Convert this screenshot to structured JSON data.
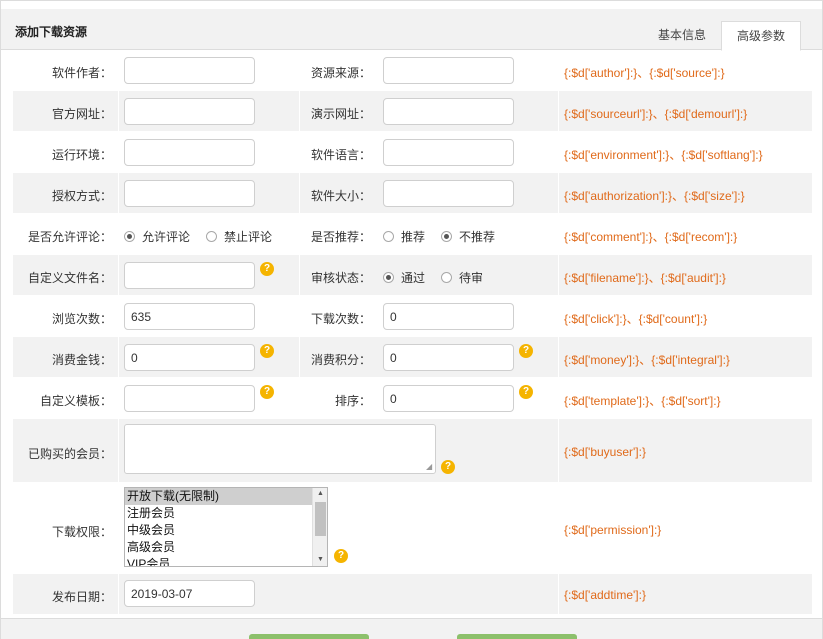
{
  "header": {
    "title": "添加下载资源"
  },
  "tabs": {
    "basic": "基本信息",
    "advanced": "高级参数"
  },
  "rows": {
    "author": {
      "label": "软件作者：",
      "value": ""
    },
    "source": {
      "label": "资源来源：",
      "value": ""
    },
    "author_code": "{:$d['author']:}、{:$d['source']:}",
    "sourceurl": {
      "label": "官方网址：",
      "value": ""
    },
    "demourl": {
      "label": "演示网址：",
      "value": ""
    },
    "url_code": "{:$d['sourceurl']:}、{:$d['demourl']:}",
    "environment": {
      "label": "运行环境：",
      "value": ""
    },
    "softlang": {
      "label": "软件语言：",
      "value": ""
    },
    "env_code": "{:$d['environment']:}、{:$d['softlang']:}",
    "authorization": {
      "label": "授权方式：",
      "value": ""
    },
    "size": {
      "label": "软件大小：",
      "value": ""
    },
    "auth_code": "{:$d['authorization']:}、{:$d['size']:}",
    "comment": {
      "label": "是否允许评论：",
      "opt_allow": "允许评论",
      "opt_forbid": "禁止评论",
      "selected": "允许评论"
    },
    "recom": {
      "label": "是否推荐：",
      "opt_yes": "推荐",
      "opt_no": "不推荐",
      "selected": "不推荐"
    },
    "comment_code": "{:$d['comment']:}、{:$d['recom']:}",
    "filename": {
      "label": "自定义文件名：",
      "value": ""
    },
    "audit": {
      "label": "审核状态：",
      "opt_pass": "通过",
      "opt_pending": "待审",
      "selected": "通过"
    },
    "filename_code": "{:$d['filename']:}、{:$d['audit']:}",
    "click": {
      "label": "浏览次数：",
      "value": "635"
    },
    "count": {
      "label": "下载次数：",
      "value": "0"
    },
    "click_code": "{:$d['click']:}、{:$d['count']:}",
    "money": {
      "label": "消费金钱：",
      "value": "0"
    },
    "integral": {
      "label": "消费积分：",
      "value": "0"
    },
    "money_code": "{:$d['money']:}、{:$d['integral']:}",
    "template": {
      "label": "自定义模板：",
      "value": ""
    },
    "sort": {
      "label": "排序：",
      "value": "0"
    },
    "template_code": "{:$d['template']:}、{:$d['sort']:}",
    "buyuser": {
      "label": "已购买的会员：",
      "value": ""
    },
    "buyuser_code": "{:$d['buyuser']:}",
    "permission": {
      "label": "下载权限：",
      "options": [
        "开放下载(无限制)",
        "注册会员",
        "中级会员",
        "高级会员",
        "VIP会员"
      ],
      "selected": "开放下载(无限制)"
    },
    "permission_code": "{:$d['permission']:}",
    "addtime": {
      "label": "发布日期：",
      "value": "2019-03-07"
    },
    "addtime_code": "{:$d['addtime']:}"
  },
  "icons": {
    "help": "help-icon"
  },
  "colors": {
    "code_text": "#e06a1a",
    "help_badge": "#f5b400",
    "button": "#8cc06b"
  }
}
